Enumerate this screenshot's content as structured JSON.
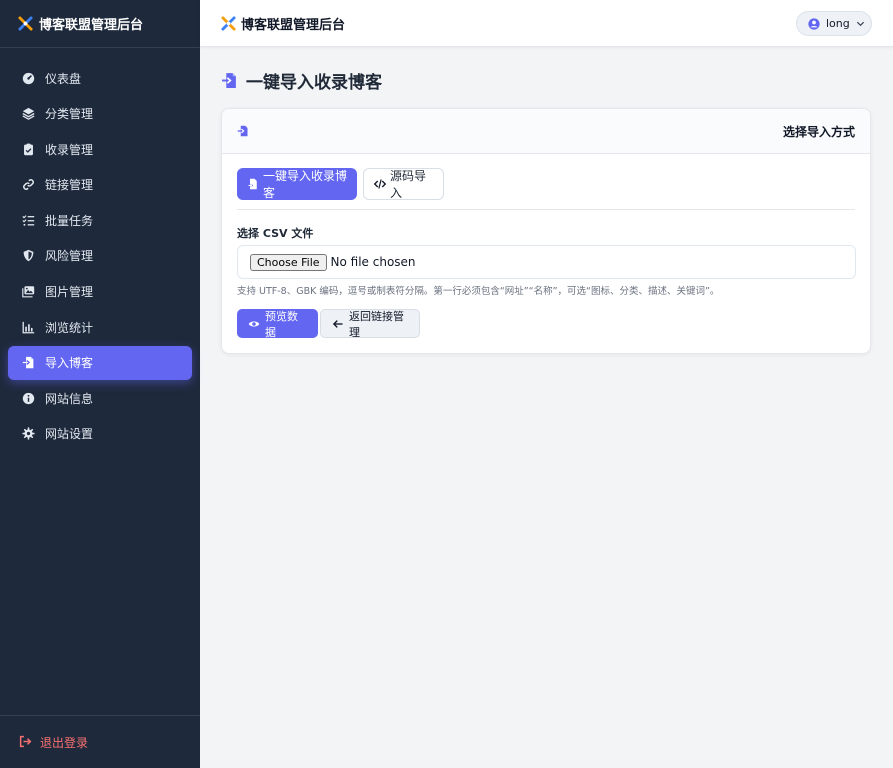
{
  "colors": {
    "sidebar_bg": "#1e293b",
    "accent": "#6366f1",
    "logout": "#f87171",
    "page_bg": "#f3f4f6"
  },
  "sidebar": {
    "brand": "博客联盟管理后台",
    "items": [
      {
        "label": "仪表盘",
        "icon": "gauge-icon"
      },
      {
        "label": "分类管理",
        "icon": "layers-icon"
      },
      {
        "label": "收录管理",
        "icon": "clipboard-check-icon"
      },
      {
        "label": "链接管理",
        "icon": "link-icon"
      },
      {
        "label": "批量任务",
        "icon": "list-check-icon"
      },
      {
        "label": "风险管理",
        "icon": "shield-icon"
      },
      {
        "label": "图片管理",
        "icon": "image-icon"
      },
      {
        "label": "浏览统计",
        "icon": "bar-chart-icon"
      },
      {
        "label": "导入博客",
        "icon": "file-import-icon",
        "active": true
      },
      {
        "label": "网站信息",
        "icon": "info-icon"
      },
      {
        "label": "网站设置",
        "icon": "gear-icon"
      }
    ],
    "logout": "退出登录"
  },
  "topbar": {
    "title": "博客联盟管理后台",
    "user": "long"
  },
  "page": {
    "title": "一键导入收录博客"
  },
  "card": {
    "header_title": "选择导入方式",
    "tabs": [
      {
        "label": "一键导入收录博客"
      },
      {
        "label": "源码导入"
      }
    ],
    "field_label": "选择 CSV 文件",
    "file_button": "Choose File",
    "file_status": "No file chosen",
    "hint": "支持 UTF-8、GBK 编码，逗号或制表符分隔。第一行必须包含“网址”“名称”，可选“图标、分类、描述、关键词”。",
    "preview_button": "预览数据",
    "back_button": "返回链接管理"
  }
}
